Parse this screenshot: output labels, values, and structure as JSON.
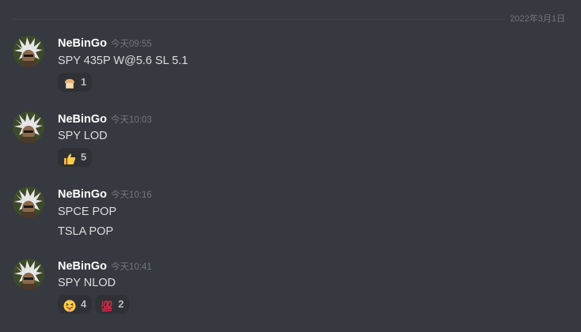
{
  "divider": {
    "date": "2022年3月1日"
  },
  "messages": [
    {
      "username": "NeBinGo",
      "timestamp": "今天09:55",
      "lines": [
        "SPY 435P W@5.6 SL 5.1"
      ],
      "reactions": [
        {
          "emoji": "bread-emoji",
          "count": "1"
        }
      ]
    },
    {
      "username": "NeBinGo",
      "timestamp": "今天10:03",
      "lines": [
        "SPY LOD"
      ],
      "reactions": [
        {
          "emoji": "thumbs-up-emoji",
          "count": "5"
        }
      ]
    },
    {
      "username": "NeBinGo",
      "timestamp": "今天10:16",
      "lines": [
        "SPCE POP",
        "TSLA POP"
      ],
      "reactions": []
    },
    {
      "username": "NeBinGo",
      "timestamp": "今天10:41",
      "lines": [
        "SPY NLOD"
      ],
      "reactions": [
        {
          "emoji": "tongue-out-face-emoji",
          "count": "4"
        },
        {
          "emoji": "hundred-points-emoji",
          "count": "2"
        }
      ]
    }
  ]
}
